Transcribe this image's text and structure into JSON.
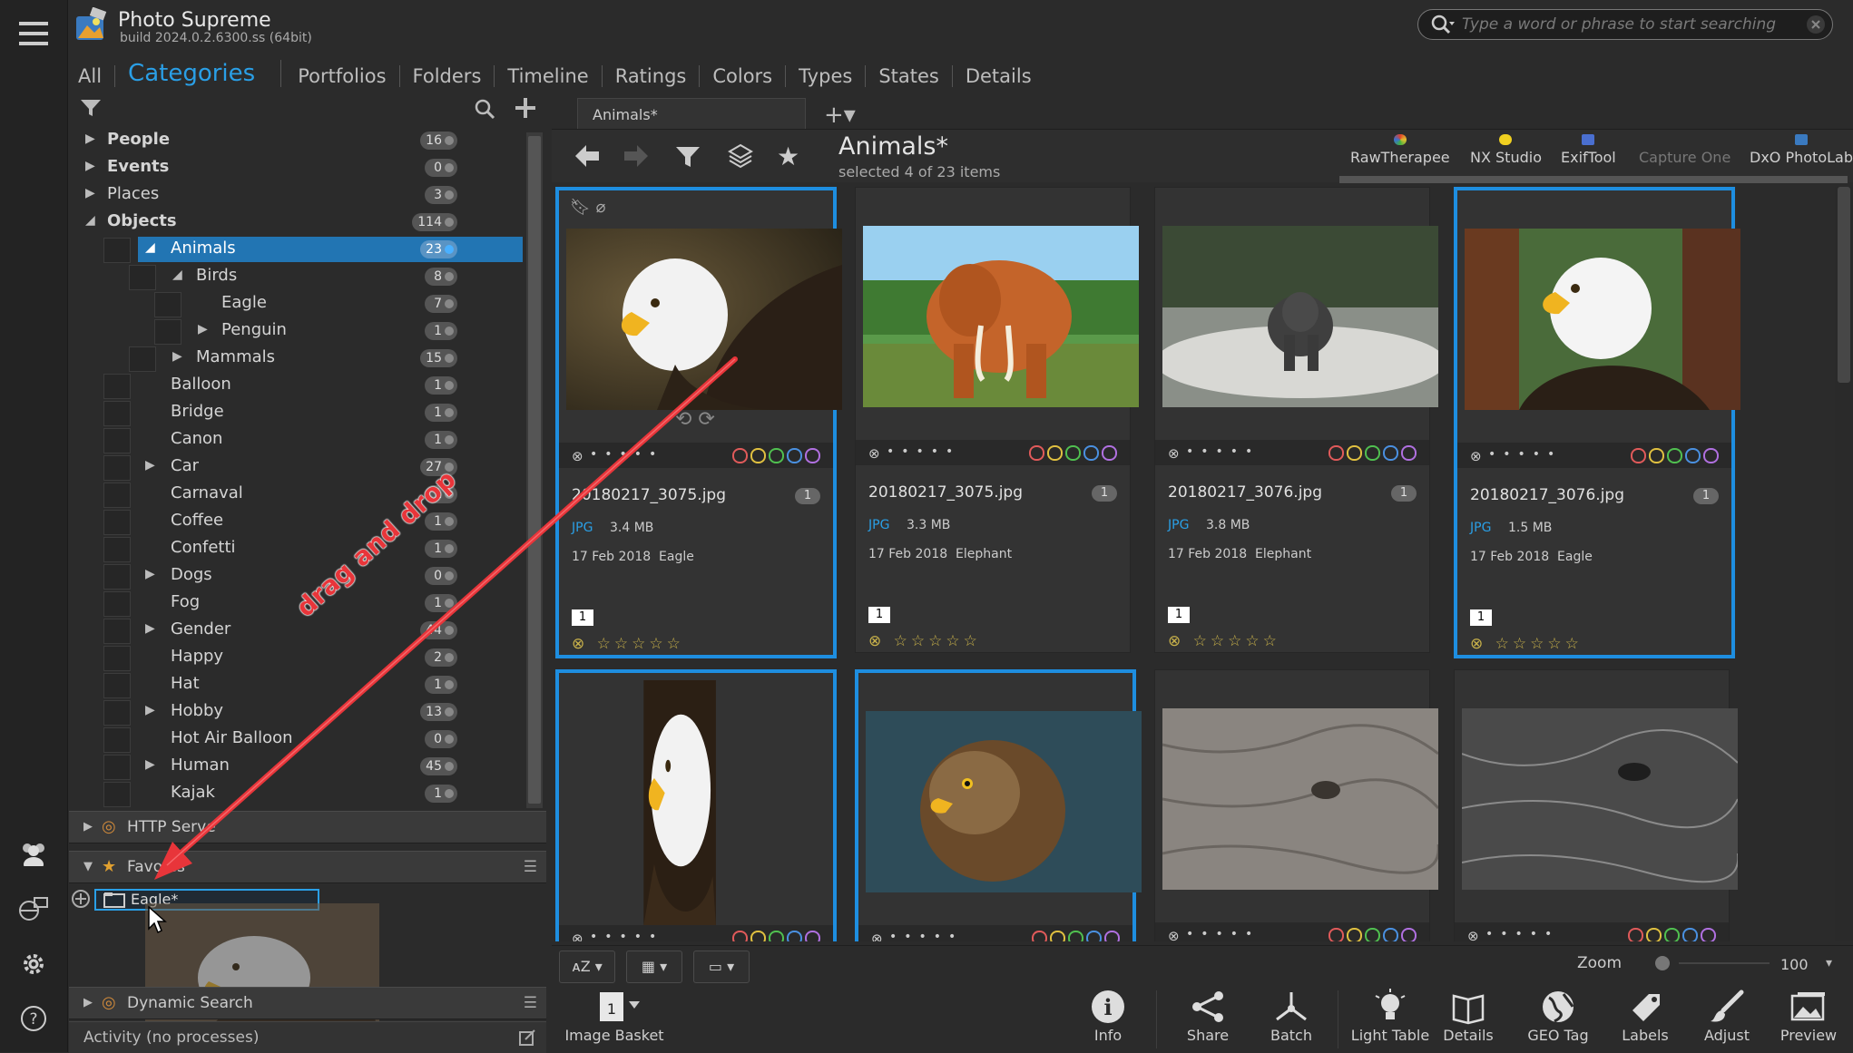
{
  "header": {
    "app_title": "Photo Supreme",
    "build": "build 2024.0.2.6300.ss (64bit)",
    "search_placeholder": "Type a word or phrase to start searching"
  },
  "tabs": [
    {
      "label": "All"
    },
    {
      "label": "Categories",
      "active": true
    },
    {
      "label": "Portfolios"
    },
    {
      "label": "Folders"
    },
    {
      "label": "Timeline"
    },
    {
      "label": "Ratings"
    },
    {
      "label": "Colors"
    },
    {
      "label": "Types"
    },
    {
      "label": "States"
    },
    {
      "label": "Details"
    }
  ],
  "categories": [
    {
      "label": "People",
      "count": "16",
      "level": 0,
      "bold": true,
      "arrow": "right",
      "check": false
    },
    {
      "label": "Events",
      "count": "0",
      "level": 0,
      "bold": true,
      "arrow": "right",
      "check": false
    },
    {
      "label": "Places",
      "count": "3",
      "level": 0,
      "bold": false,
      "arrow": "right",
      "check": false
    },
    {
      "label": "Objects",
      "count": "114",
      "level": 0,
      "bold": true,
      "arrow": "down",
      "check": false
    },
    {
      "label": "Animals",
      "count": "23",
      "level": 1,
      "bold": false,
      "arrow": "down",
      "check": true,
      "selected": true
    },
    {
      "label": "Birds",
      "count": "8",
      "level": 2,
      "bold": false,
      "arrow": "down",
      "check": true
    },
    {
      "label": "Eagle",
      "count": "7",
      "level": 3,
      "bold": false,
      "arrow": "",
      "check": true
    },
    {
      "label": "Penguin",
      "count": "1",
      "level": 3,
      "bold": false,
      "arrow": "right",
      "check": true
    },
    {
      "label": "Mammals",
      "count": "15",
      "level": 2,
      "bold": false,
      "arrow": "right",
      "check": true
    },
    {
      "label": "Balloon",
      "count": "1",
      "level": 1,
      "bold": false,
      "arrow": "",
      "check": true
    },
    {
      "label": "Bridge",
      "count": "1",
      "level": 1,
      "bold": false,
      "arrow": "",
      "check": true
    },
    {
      "label": "Canon",
      "count": "1",
      "level": 1,
      "bold": false,
      "arrow": "",
      "check": true
    },
    {
      "label": "Car",
      "count": "27",
      "level": 1,
      "bold": false,
      "arrow": "right",
      "check": true
    },
    {
      "label": "Carnaval",
      "count": "1",
      "level": 1,
      "bold": false,
      "arrow": "",
      "check": true
    },
    {
      "label": "Coffee",
      "count": "1",
      "level": 1,
      "bold": false,
      "arrow": "",
      "check": true
    },
    {
      "label": "Confetti",
      "count": "1",
      "level": 1,
      "bold": false,
      "arrow": "",
      "check": true
    },
    {
      "label": "Dogs",
      "count": "0",
      "level": 1,
      "bold": false,
      "arrow": "right",
      "check": true
    },
    {
      "label": "Fog",
      "count": "1",
      "level": 1,
      "bold": false,
      "arrow": "",
      "check": true
    },
    {
      "label": "Gender",
      "count": "44",
      "level": 1,
      "bold": false,
      "arrow": "right",
      "check": true
    },
    {
      "label": "Happy",
      "count": "2",
      "level": 1,
      "bold": false,
      "arrow": "",
      "check": true
    },
    {
      "label": "Hat",
      "count": "1",
      "level": 1,
      "bold": false,
      "arrow": "",
      "check": true
    },
    {
      "label": "Hobby",
      "count": "13",
      "level": 1,
      "bold": false,
      "arrow": "right",
      "check": true
    },
    {
      "label": "Hot Air Balloon",
      "count": "0",
      "level": 1,
      "bold": false,
      "arrow": "",
      "check": true
    },
    {
      "label": "Human",
      "count": "45",
      "level": 1,
      "bold": false,
      "arrow": "right",
      "check": true
    },
    {
      "label": "Kajak",
      "count": "1",
      "level": 1,
      "bold": false,
      "arrow": "",
      "check": true
    }
  ],
  "sections": {
    "http_server": "HTTP Serve",
    "favorites": "Favo     es",
    "favorite_item": "Eagle*",
    "dynamic_search": "Dynamic Search",
    "activity": "Activity (no processes)"
  },
  "annotation": {
    "text": "drag and drop",
    "color": "#e8353a"
  },
  "browser": {
    "doc_tab": "Animals*",
    "title": "Animals*",
    "subtitle": "selected 4 of 23 items"
  },
  "external_tools": [
    {
      "label": "RawTherapee",
      "color": "#e0a030",
      "enabled": true
    },
    {
      "label": "NX Studio",
      "color": "#f0d020",
      "enabled": true
    },
    {
      "label": "ExifTool",
      "color": "#4a6fd0",
      "enabled": true
    },
    {
      "label": "Capture One",
      "color": "#555555",
      "enabled": false
    },
    {
      "label": "DxO PhotoLab",
      "color": "#3a7ac0",
      "enabled": true
    }
  ],
  "thumbnails": [
    {
      "file": "20180217_3075.jpg",
      "type": "JPG",
      "size": "3.4 MB",
      "date": "17 Feb 2018",
      "tag": "Eagle",
      "version": "1",
      "badge": "1",
      "selected": true,
      "photo": "eagle1"
    },
    {
      "file": "20180217_3075.jpg",
      "type": "JPG",
      "size": "3.3 MB",
      "date": "17 Feb 2018",
      "tag": "Elephant",
      "version": "1",
      "badge": "1",
      "selected": false,
      "photo": "elephant1"
    },
    {
      "file": "20180217_3076.jpg",
      "type": "JPG",
      "size": "3.8 MB",
      "date": "17 Feb 2018",
      "tag": "Elephant",
      "version": "1",
      "badge": "1",
      "selected": false,
      "photo": "elephant2"
    },
    {
      "file": "20180217_3076.jpg",
      "type": "JPG",
      "size": "1.5 MB",
      "date": "17 Feb 2018",
      "tag": "Eagle",
      "version": "1",
      "badge": "1",
      "selected": true,
      "photo": "eagle2"
    },
    {
      "file": "",
      "type": "",
      "size": "",
      "date": "",
      "tag": "",
      "version": "",
      "badge": "",
      "selected": true,
      "photo": "eagle3"
    },
    {
      "file": "",
      "type": "",
      "size": "",
      "date": "",
      "tag": "",
      "version": "",
      "badge": "",
      "selected": true,
      "photo": "hawk"
    },
    {
      "file": "",
      "type": "",
      "size": "",
      "date": "",
      "tag": "",
      "version": "",
      "badge": "",
      "selected": false,
      "photo": "skin1"
    },
    {
      "file": "",
      "type": "",
      "size": "",
      "date": "",
      "tag": "",
      "version": "",
      "badge": "",
      "selected": false,
      "photo": "skin2"
    }
  ],
  "color_labels": [
    "#e05a5a",
    "#e0c040",
    "#50c050",
    "#4a90e0",
    "#b070e0"
  ],
  "bottom": {
    "zoom_label": "Zoom",
    "zoom_value": "100",
    "image_basket": "Image Basket",
    "tools": [
      "Info",
      "Share",
      "Batch",
      "Light Table",
      "Details",
      "GEO Tag",
      "Labels",
      "Adjust",
      "Preview"
    ]
  }
}
